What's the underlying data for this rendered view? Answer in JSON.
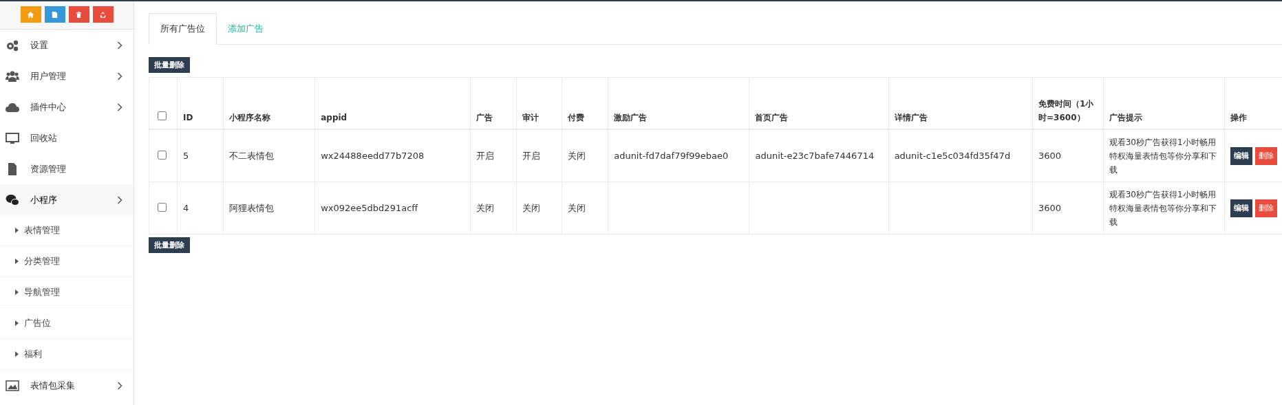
{
  "sidebar": {
    "quick_buttons": [
      {
        "kind": "home",
        "color": "#f39c12"
      },
      {
        "kind": "file",
        "color": "#3498db"
      },
      {
        "kind": "trash",
        "color": "#e74c3c"
      },
      {
        "kind": "recycle",
        "color": "#e74c3c"
      }
    ],
    "items": [
      {
        "label": "设置",
        "kind": "gears",
        "expandable": true,
        "selected": false
      },
      {
        "label": "用户管理",
        "kind": "users",
        "expandable": true,
        "selected": false
      },
      {
        "label": "插件中心",
        "kind": "cloud",
        "expandable": true,
        "selected": false
      },
      {
        "label": "回收站",
        "kind": "monitor",
        "expandable": false,
        "selected": false
      },
      {
        "label": "资源管理",
        "kind": "file",
        "expandable": false,
        "selected": false
      },
      {
        "label": "小程序",
        "kind": "chat",
        "expandable": true,
        "selected": true,
        "children": [
          {
            "label": "表情管理"
          },
          {
            "label": "分类管理"
          },
          {
            "label": "导航管理"
          },
          {
            "label": "广告位"
          },
          {
            "label": "福利"
          }
        ]
      },
      {
        "label": "表情包采集",
        "kind": "image",
        "expandable": true,
        "selected": false
      }
    ]
  },
  "tabs": [
    {
      "label": "所有广告位",
      "selected": true
    },
    {
      "label": "添加广告",
      "selected": false
    }
  ],
  "bulk_delete_top": "批量删除",
  "table": {
    "select_all_checked": false,
    "columns": [
      "ID",
      "小程序名称",
      "appid",
      "广告",
      "审计",
      "付费",
      "激励广告",
      "首页广告",
      "详情广告",
      "免费时间（1小时=3600）",
      "广告提示",
      "操作"
    ],
    "rows": [
      {
        "checked": false,
        "cells": [
          "5",
          "不二表情包",
          "wx24488eedd77b7208",
          "开启",
          "开启",
          "关闭",
          "adunit-fd7daf79f99ebae0",
          "adunit-e23c7bafe7446714",
          "adunit-c1e5c034fd35f47d",
          "3600",
          "观看30秒广告获得1小时畅用特权海量表情包等你分享和下载"
        ],
        "edit": "编辑",
        "delete": "删除"
      },
      {
        "checked": false,
        "cells": [
          "4",
          "阿狸表情包",
          "wx092ee5dbd291acff",
          "关闭",
          "关闭",
          "关闭",
          "",
          "",
          "",
          "3600",
          "观看30秒广告获得1小时畅用特权海量表情包等你分享和下载"
        ],
        "edit": "编辑",
        "delete": "删除"
      }
    ]
  },
  "bulk_delete_bottom": "批量删除"
}
